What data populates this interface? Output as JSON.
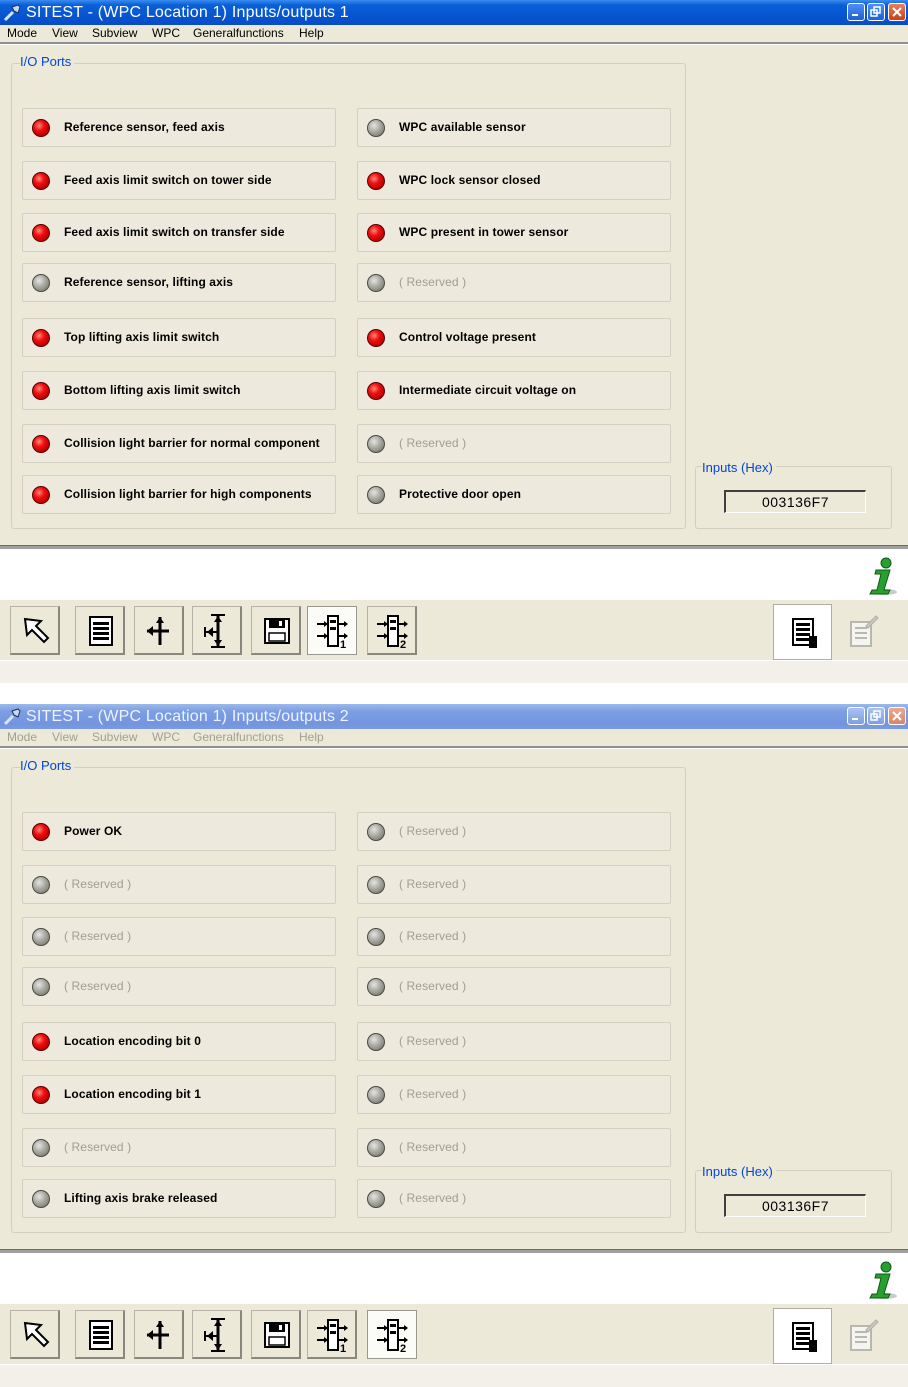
{
  "windows": [
    {
      "title": "SITEST - (WPC Location 1) Inputs/outputs 1",
      "active": true,
      "menu": [
        "Mode",
        "View",
        "Subview",
        "WPC",
        "Generalfunctions",
        "Help"
      ],
      "group_label": "I/O Ports",
      "left_column": [
        {
          "label": "Reference sensor, feed axis",
          "state": "on"
        },
        {
          "label": "Feed axis limit switch on tower side",
          "state": "on"
        },
        {
          "label": "Feed axis limit switch on transfer side",
          "state": "on"
        },
        {
          "label": "Reference sensor, lifting axis",
          "state": "off"
        },
        {
          "label": "Top lifting axis limit switch",
          "state": "on"
        },
        {
          "label": "Bottom lifting axis limit switch",
          "state": "on"
        },
        {
          "label": "Collision light barrier for normal component",
          "state": "on"
        },
        {
          "label": "Collision light barrier for high components",
          "state": "on"
        }
      ],
      "right_column": [
        {
          "label": "WPC available sensor",
          "state": "off"
        },
        {
          "label": "WPC lock sensor closed",
          "state": "on"
        },
        {
          "label": "WPC present in tower sensor",
          "state": "on"
        },
        {
          "label": "( Reserved )",
          "state": "off",
          "reserved": true
        },
        {
          "label": "Control voltage present",
          "state": "on"
        },
        {
          "label": "Intermediate circuit voltage on",
          "state": "on"
        },
        {
          "label": "( Reserved )",
          "state": "off",
          "reserved": true
        },
        {
          "label": "Protective door open",
          "state": "off"
        }
      ],
      "hex_label": "Inputs (Hex)",
      "hex_value": "003136F7",
      "active_page_button": 1
    },
    {
      "title": "SITEST - (WPC Location 1) Inputs/outputs 2",
      "active": false,
      "menu": [
        "Mode",
        "View",
        "Subview",
        "WPC",
        "Generalfunctions",
        "Help"
      ],
      "group_label": "I/O Ports",
      "left_column": [
        {
          "label": "Power OK",
          "state": "on"
        },
        {
          "label": "( Reserved )",
          "state": "off",
          "reserved": true
        },
        {
          "label": "( Reserved )",
          "state": "off",
          "reserved": true
        },
        {
          "label": "( Reserved )",
          "state": "off",
          "reserved": true
        },
        {
          "label": "Location encoding bit 0",
          "state": "on"
        },
        {
          "label": "Location encoding bit 1",
          "state": "on"
        },
        {
          "label": "( Reserved )",
          "state": "off",
          "reserved": true
        },
        {
          "label": "Lifting axis brake released",
          "state": "off"
        }
      ],
      "right_column": [
        {
          "label": "( Reserved )",
          "state": "off",
          "reserved": true
        },
        {
          "label": "( Reserved )",
          "state": "off",
          "reserved": true
        },
        {
          "label": "( Reserved )",
          "state": "off",
          "reserved": true
        },
        {
          "label": "( Reserved )",
          "state": "off",
          "reserved": true
        },
        {
          "label": "( Reserved )",
          "state": "off",
          "reserved": true
        },
        {
          "label": "( Reserved )",
          "state": "off",
          "reserved": true
        },
        {
          "label": "( Reserved )",
          "state": "off",
          "reserved": true
        },
        {
          "label": "( Reserved )",
          "state": "off",
          "reserved": true
        }
      ],
      "hex_label": "Inputs (Hex)",
      "hex_value": "003136F7",
      "active_page_button": 2
    }
  ],
  "toolbar_icons": [
    "pointer-arrow-icon",
    "list-icon",
    "feed-axis-icon",
    "lifting-axis-icon",
    "save-disk-icon",
    "io-page-1-icon",
    "io-page-2-icon"
  ],
  "right_toolbar_icons": [
    "report-icon",
    "notes-disabled-icon"
  ],
  "colors": {
    "led_on": "#f01010",
    "led_off": "#a8a8a0",
    "title_active": "#0553d0",
    "title_inactive": "#7b9ee3",
    "group_label": "#0046d5"
  }
}
